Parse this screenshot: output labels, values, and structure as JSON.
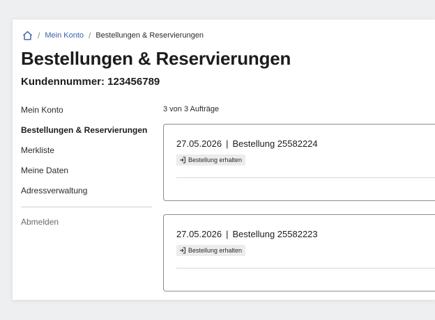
{
  "breadcrumb": {
    "home_icon": "home-icon",
    "items": [
      {
        "label": "Mein Konto"
      },
      {
        "label": "Bestellungen & Reservierungen"
      }
    ]
  },
  "page": {
    "title": "Bestellungen & Reservierungen",
    "customer_number": "Kundennummer: 123456789"
  },
  "sidebar": {
    "items": [
      {
        "label": "Mein Konto"
      },
      {
        "label": "Bestellungen & Reservierungen",
        "active": true
      },
      {
        "label": "Merkliste"
      },
      {
        "label": "Meine Daten"
      },
      {
        "label": "Adressverwaltung"
      }
    ],
    "logout": "Abmelden"
  },
  "orders": {
    "count_text": "3 von 3 Aufträge",
    "list": [
      {
        "date": "27.05.2026",
        "separator": "|",
        "title": "Bestellung 25582224",
        "status": "Bestellung erhalten",
        "status_icon": "sign-in-icon"
      },
      {
        "date": "27.05.2026",
        "separator": "|",
        "title": "Bestellung 25582223",
        "status": "Bestellung erhalten",
        "status_icon": "sign-in-icon"
      }
    ]
  },
  "colors": {
    "link": "#3a5fa8",
    "border": "#8d8d8d",
    "badge_bg": "#ececec",
    "background": "#eeeff1"
  }
}
